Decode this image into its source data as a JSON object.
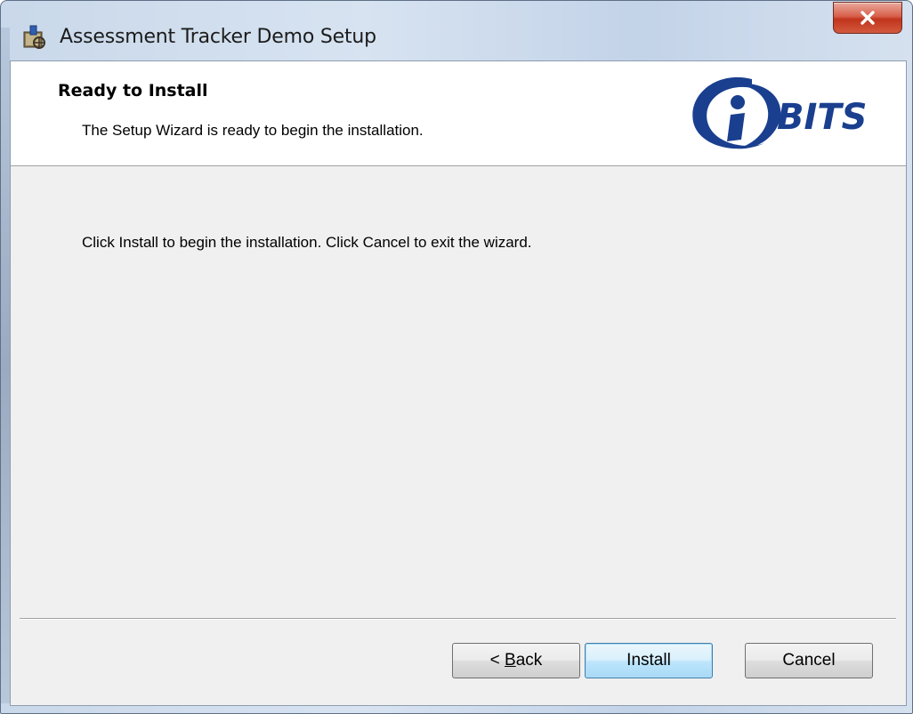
{
  "window": {
    "title": "Assessment Tracker Demo Setup",
    "close_label": "x"
  },
  "banner": {
    "title": "Ready to Install",
    "subtitle": "The Setup Wizard is ready to begin the installation.",
    "logo_text": "BITS",
    "logo_colors": {
      "primary": "#1a3f8f",
      "accent": "#2b5cb8"
    }
  },
  "body": {
    "message": "Click Install to begin the installation.  Click Cancel to exit the wizard."
  },
  "buttons": {
    "back_prefix": "< ",
    "back_mnemonic": "B",
    "back_rest": "ack",
    "install": "Install",
    "cancel": "Cancel"
  },
  "icons": {
    "app": "installer-package-icon",
    "close": "close-icon"
  }
}
